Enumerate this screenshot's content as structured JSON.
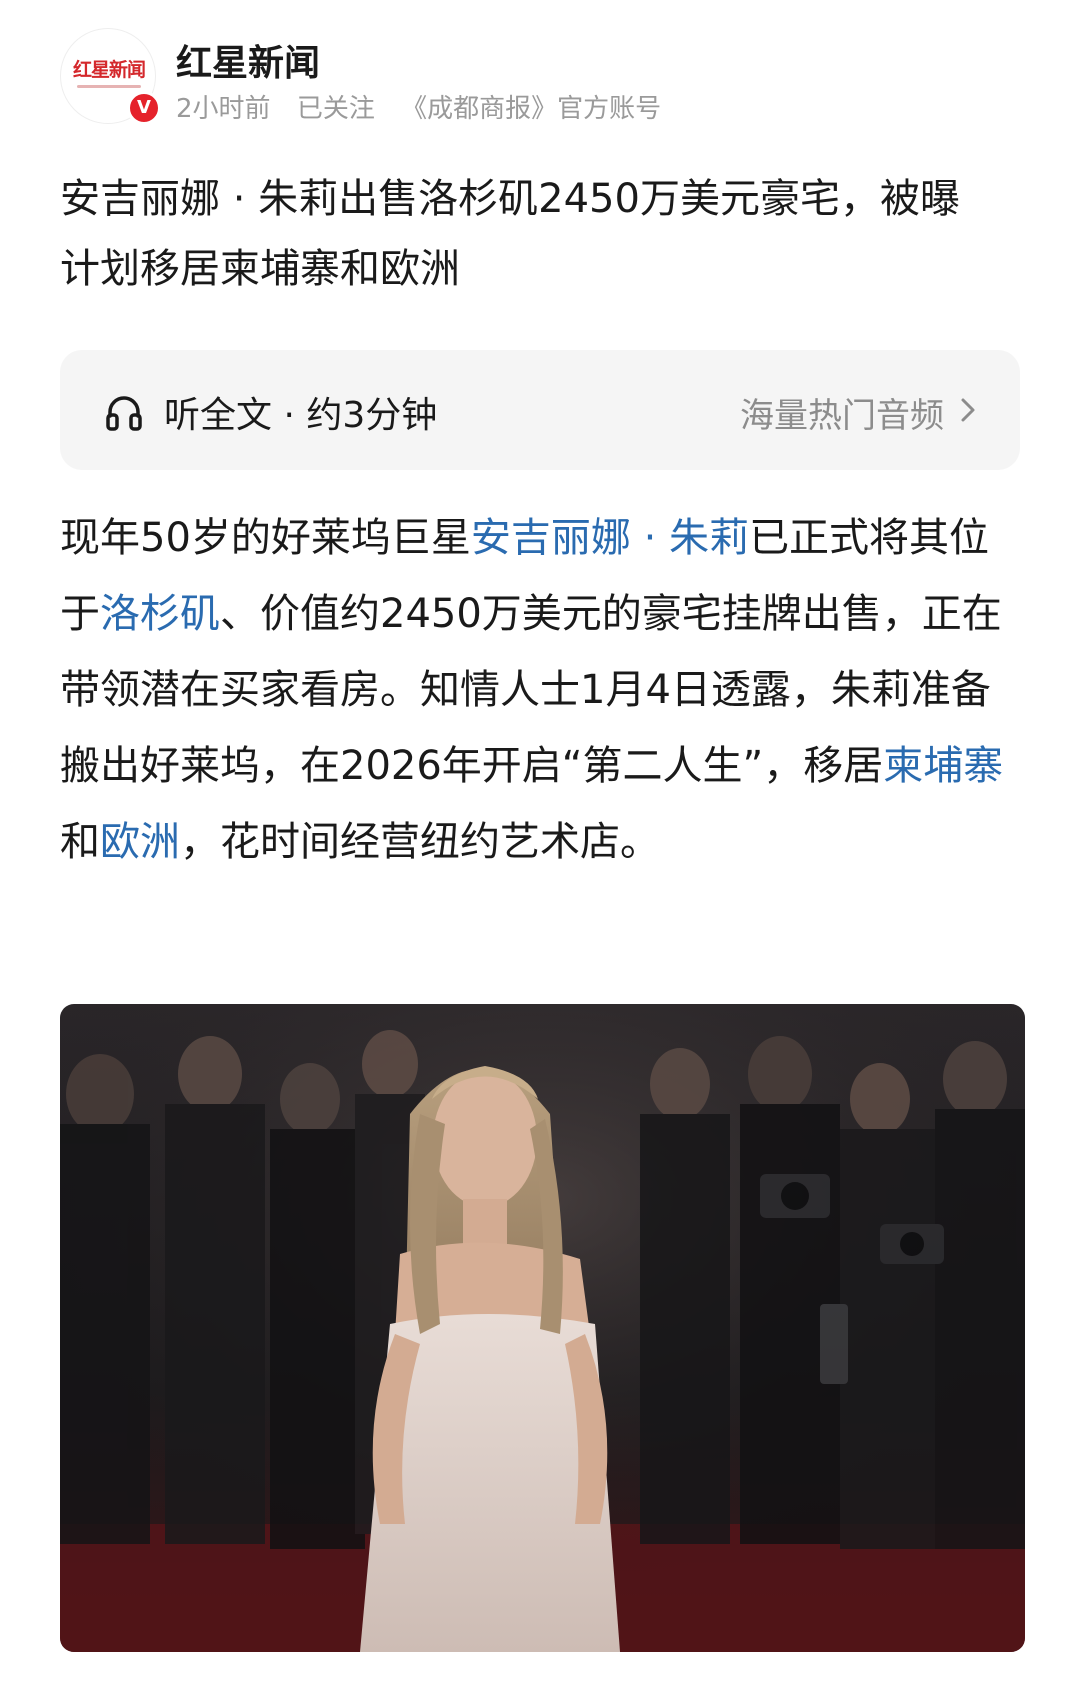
{
  "header": {
    "avatar_text": "红星新闻",
    "verified_badge": "V",
    "source_name": "红星新闻",
    "time_ago": "2小时前",
    "follow_status": "已关注",
    "account_desc": "《成都商报》官方账号"
  },
  "headline": "安吉丽娜 · 朱莉出售洛杉矶2450万美元豪宅，被曝计划移居柬埔寨和欧洲",
  "audio": {
    "label": "听全文 · 约3分钟",
    "more_label": "海量热门音频"
  },
  "body": {
    "p1": "现年50岁的好莱坞巨星",
    "link_person": "安吉丽娜 · 朱莉",
    "p2": "已正式将其位于",
    "link_city": "洛杉矶",
    "p3": "、价值约2450万美元的豪宅挂牌出售，正在带领潜在买家看房。知情人士1月4日透露，朱莉准备搬出好莱坞，在2026年开启“第二人生”，移居",
    "link_country": "柬埔寨",
    "p4": "和",
    "link_region": "欧洲",
    "p5": "，花时间经营纽约艺术店。"
  },
  "colors": {
    "link": "#2a6bb0",
    "badge": "#e5222b",
    "brand": "#d4282c"
  },
  "icons": {
    "audio": "headphone-icon",
    "more": "chevron-right-icon"
  }
}
